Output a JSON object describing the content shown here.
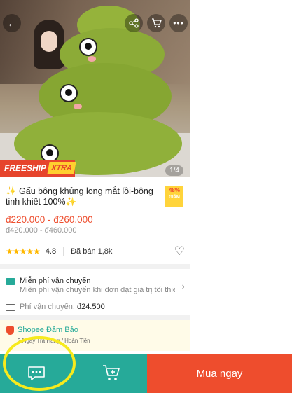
{
  "product": {
    "image_counter": "1/4",
    "freeship_label": "FREESHIP",
    "freeship_xtra": "XTRA",
    "title": "✨ Gấu bông khủng long mắt lồi-bông tinh khiết 100%✨",
    "discount_percent": "48%",
    "discount_label": "GIẢM",
    "price": "đ220.000 - đ260.000",
    "old_price": "đ420.000 - đ460.000",
    "rating": "4.8",
    "rating_stars": 5,
    "sold": "Đã bán 1,8k"
  },
  "shipping": {
    "free_title": "Miễn phí vận chuyển",
    "free_sub": "Miễn phí vận chuyển khi đơn đạt giá trị tối thiểu",
    "fee_label": "Phí vận chuyển:",
    "fee_value": "đ24.500"
  },
  "guarantee": {
    "title": "Shopee Đảm Bảo",
    "sub": "3 Ngày Trả Hàng / Hoàn Tiền"
  },
  "bottom_bar": {
    "buy_label": "Mua ngay"
  },
  "icons": {
    "back": "back-arrow-icon",
    "share": "share-icon",
    "cart": "cart-icon",
    "more": "more-icon",
    "heart": "heart-icon",
    "chat": "chat-icon",
    "add_to_cart": "add-to-cart-icon"
  },
  "colors": {
    "primary": "#ee4d2d",
    "teal": "#26aa99",
    "star": "#ffb800",
    "highlight": "#f7ea1c"
  }
}
